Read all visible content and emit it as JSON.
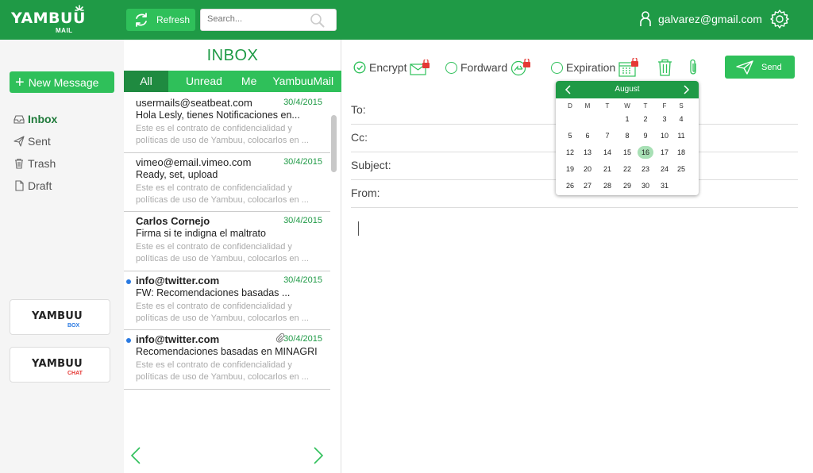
{
  "brand": {
    "name": "YAMBUU",
    "sub": "MAIL",
    "color": "#1f9a46",
    "accent": "#2fc05a"
  },
  "header": {
    "refresh_label": "Refresh",
    "search_placeholder": "Search...",
    "user_email": "galvarez@gmail.com"
  },
  "sidebar": {
    "new_message": "New Message",
    "folders": [
      {
        "label": "Inbox",
        "icon": "inbox-icon",
        "active": true
      },
      {
        "label": "Sent",
        "icon": "paper-plane-icon"
      },
      {
        "label": "Trash",
        "icon": "trash-icon"
      },
      {
        "label": "Draft",
        "icon": "document-icon"
      }
    ],
    "apps": [
      {
        "name": "YAMBUU",
        "sub": "BOX",
        "sub_color": "#2a7ae2"
      },
      {
        "name": "YAMBUU",
        "sub": "CHAT",
        "sub_color": "#e53935"
      }
    ]
  },
  "inbox": {
    "title": "INBOX",
    "tabs": [
      "All",
      "Unread",
      "Me",
      "YambuuMail"
    ],
    "active_tab": "All",
    "mails": [
      {
        "from": "usermails@seatbeat.com",
        "date": "30/4/2015",
        "subject": "Hola Lesly, tienes Notificaciones en...",
        "preview": "Este es el contrato de confidencialidad y políticas de uso de Yambuu, colocarlos en ...",
        "unread": false,
        "attachment": false
      },
      {
        "from": "vimeo@email.vimeo.com",
        "date": "30/4/2015",
        "subject": "Ready, set, upload",
        "preview": "Este es el contrato de confidencialidad y políticas de uso de Yambuu, colocarlos en ...",
        "unread": false,
        "attachment": false
      },
      {
        "from": "Carlos Cornejo",
        "date": "30/4/2015",
        "subject": "Firma si te indigna el maltrato",
        "preview": "Este es el contrato de confidencialidad y políticas de uso de Yambuu, colocarlos en ...",
        "unread": false,
        "attachment": false
      },
      {
        "from": "info@twitter.com",
        "date": "30/4/2015",
        "subject": "FW: Recomendaciones basadas ...",
        "preview": "Este es el contrato de confidencialidad y políticas de uso de Yambuu, colocarlos en ...",
        "unread": true,
        "attachment": false
      },
      {
        "from": "info@twitter.com",
        "date": "30/4/2015",
        "subject": "Recomendaciones basadas en MINAGRI",
        "preview": "Este es el contrato de confidencialidad y políticas de uso de Yambuu, colocarlos en ...",
        "unread": true,
        "attachment": true
      }
    ]
  },
  "compose": {
    "options": [
      {
        "label": "Encrypt",
        "checked": true,
        "icon": "locked-envelope-icon"
      },
      {
        "label": "Fordward",
        "checked": false,
        "icon": "locked-forward-icon"
      },
      {
        "label": "Expiration",
        "checked": false,
        "icon": "locked-calendar-icon"
      }
    ],
    "send_label": "Send",
    "fields": [
      {
        "label": "To:",
        "value": ""
      },
      {
        "label": "Cc:",
        "value": ""
      },
      {
        "label": "Subject:",
        "value": ""
      },
      {
        "label": "From:",
        "value": ""
      }
    ]
  },
  "calendar": {
    "month": "August",
    "weekdays": [
      "D",
      "M",
      "T",
      "W",
      "T",
      "F",
      "S"
    ],
    "selected_day": 16,
    "weeks": [
      [
        "",
        "",
        "",
        "",
        "1",
        "2",
        "3",
        "4"
      ],
      [
        "",
        "5",
        "6",
        "7",
        "8",
        "9",
        "10",
        "11"
      ],
      [
        "",
        "12",
        "13",
        "14",
        "15",
        "16",
        "17",
        "18"
      ],
      [
        "",
        "19",
        "20",
        "21",
        "22",
        "23",
        "24",
        "25"
      ],
      [
        "",
        "26",
        "27",
        "28",
        "29",
        "30",
        "31",
        ""
      ]
    ]
  }
}
